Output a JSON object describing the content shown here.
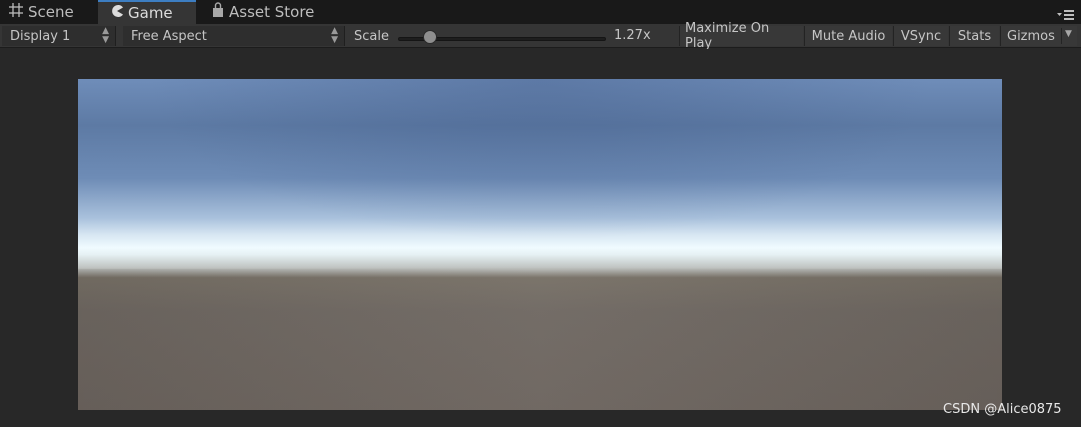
{
  "tabs": [
    {
      "label": "Scene",
      "icon": "grid-icon",
      "active": false
    },
    {
      "label": "Game",
      "icon": "pacman-icon",
      "active": true
    },
    {
      "label": "Asset Store",
      "icon": "shopping-bag-icon",
      "active": false
    }
  ],
  "toolbar": {
    "display": "Display 1",
    "aspect": "Free Aspect",
    "scale_label": "Scale",
    "scale_value": "1.27x",
    "scale_fraction": 0.03,
    "maximize_on_play": "Maximize On Play",
    "mute_audio": "Mute Audio",
    "vsync": "VSync",
    "stats": "Stats",
    "gizmos": "Gizmos"
  },
  "colors": {
    "accent": "#3d7ec2",
    "sky_top": "#5d7aa4",
    "horizon": "#f0fbff",
    "ground": "#6c645e"
  },
  "watermark": "CSDN @Alice0875"
}
